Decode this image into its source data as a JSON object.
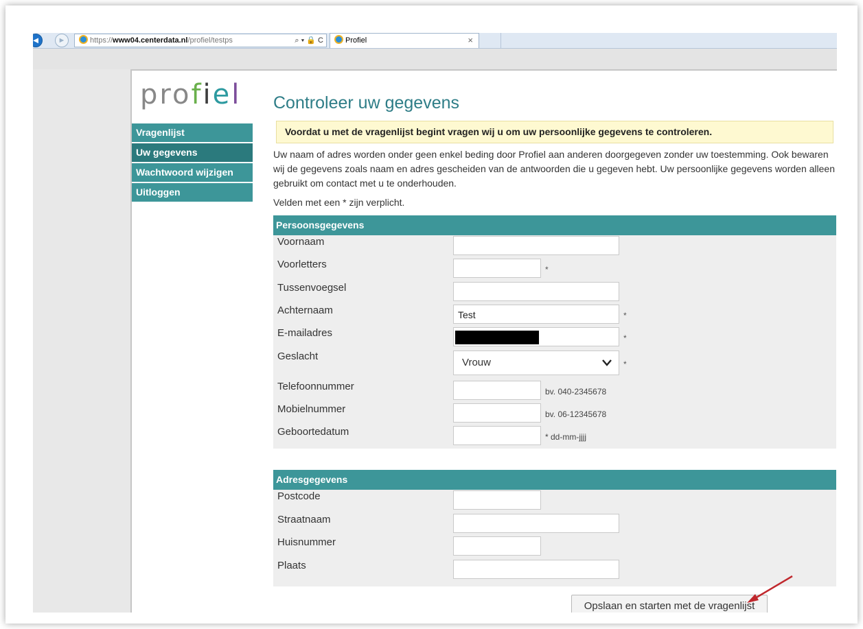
{
  "browser": {
    "url_prefix": "https://",
    "url_host": "www04.centerdata.nl",
    "url_path": "/profiel/testps",
    "address_icons": "⌕ ▾ 🔒 C",
    "tab_title": "Profiel",
    "tab_close": "×"
  },
  "logo": {
    "p1": "pro",
    "f": "f",
    "i": "i",
    "e": "e",
    "l": "l"
  },
  "sidebar": {
    "items": [
      {
        "label": "Vragenlijst"
      },
      {
        "label": "Uw gegevens"
      },
      {
        "label": "Wachtwoord wijzigen"
      },
      {
        "label": "Uitloggen"
      }
    ]
  },
  "main": {
    "title": "Controleer uw gegevens",
    "notice": "Voordat u met de vragenlijst begint vragen wij u om uw persoonlijke gegevens te controleren.",
    "intro": "Uw naam of adres worden onder geen enkel beding door Profiel aan anderen doorgegeven zonder uw toestemming. Ook bewaren wij de gegevens zoals naam en adres gescheiden van de antwoorden die u gegeven hebt. Uw persoonlijke gegevens worden alleen gebruikt om contact met u te onderhouden.",
    "required_note": "Velden met een * zijn verplicht."
  },
  "personal": {
    "header": "Persoonsgegevens",
    "voornaam": {
      "label": "Voornaam",
      "value": ""
    },
    "voorletters": {
      "label": "Voorletters",
      "value": "",
      "star": "*"
    },
    "tussenvoegsel": {
      "label": "Tussenvoegsel",
      "value": ""
    },
    "achternaam": {
      "label": "Achternaam",
      "value": "Test",
      "star": "*"
    },
    "email": {
      "label": "E-mailadres",
      "star": "*"
    },
    "geslacht": {
      "label": "Geslacht",
      "value": "Vrouw",
      "star": "*"
    },
    "telefoon": {
      "label": "Telefoonnummer",
      "value": "",
      "hint": "bv. 040-2345678"
    },
    "mobiel": {
      "label": "Mobielnummer",
      "value": "",
      "hint": "bv. 06-12345678"
    },
    "geboortedatum": {
      "label": "Geboortedatum",
      "value": "",
      "hint": "* dd-mm-jjjj"
    }
  },
  "address": {
    "header": "Adresgegevens",
    "postcode": {
      "label": "Postcode",
      "value": ""
    },
    "straatnaam": {
      "label": "Straatnaam",
      "value": ""
    },
    "huisnummer": {
      "label": "Huisnummer",
      "value": ""
    },
    "plaats": {
      "label": "Plaats",
      "value": ""
    }
  },
  "submit_label": "Opslaan en starten met de vragenlijst",
  "colors": {
    "teal": "#3d9699",
    "title": "#2e7d87",
    "notice_bg": "#fef9d1",
    "arrow": "#c0282d"
  }
}
